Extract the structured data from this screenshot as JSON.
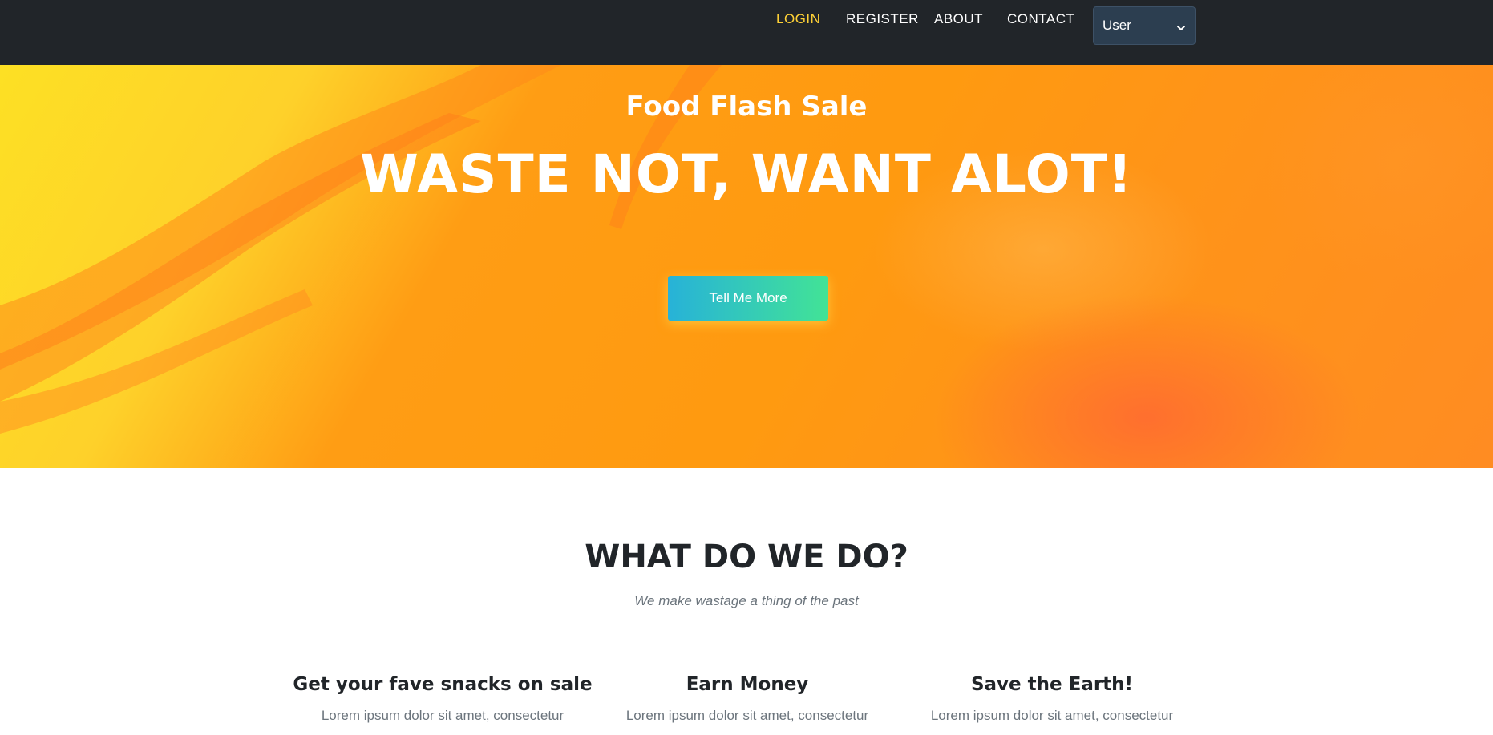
{
  "navbar": {
    "links": [
      {
        "label": "LOGIN",
        "active": true
      },
      {
        "label": "REGISTER",
        "active": false
      },
      {
        "label": "ABOUT",
        "active": false
      },
      {
        "label": "CONTACT",
        "active": false
      }
    ],
    "role_select": {
      "selected": "User"
    }
  },
  "hero": {
    "subtitle": "Food Flash Sale",
    "title": "WASTE NOT, WANT ALOT!",
    "button_label": "Tell Me More"
  },
  "services": {
    "heading": "WHAT DO WE DO?",
    "subheading": "We make wastage a thing of the past",
    "items": [
      {
        "heading": "Get your fave snacks on sale",
        "text": "Lorem ipsum dolor sit amet, consectetur"
      },
      {
        "heading": "Earn Money",
        "text": "Lorem ipsum dolor sit amet, consectetur"
      },
      {
        "heading": "Save the Earth!",
        "text": "Lorem ipsum dolor sit amet, consectetur"
      }
    ]
  },
  "colors": {
    "navbar_bg": "#212529",
    "active_link": "#fed136",
    "hero_primary": "#ff9a10",
    "hero_yellow": "#fde024",
    "button_gradient_start": "#27b2d8",
    "button_gradient_end": "#42e396"
  },
  "icons": {
    "select_caret": "chevron-down-icon"
  }
}
